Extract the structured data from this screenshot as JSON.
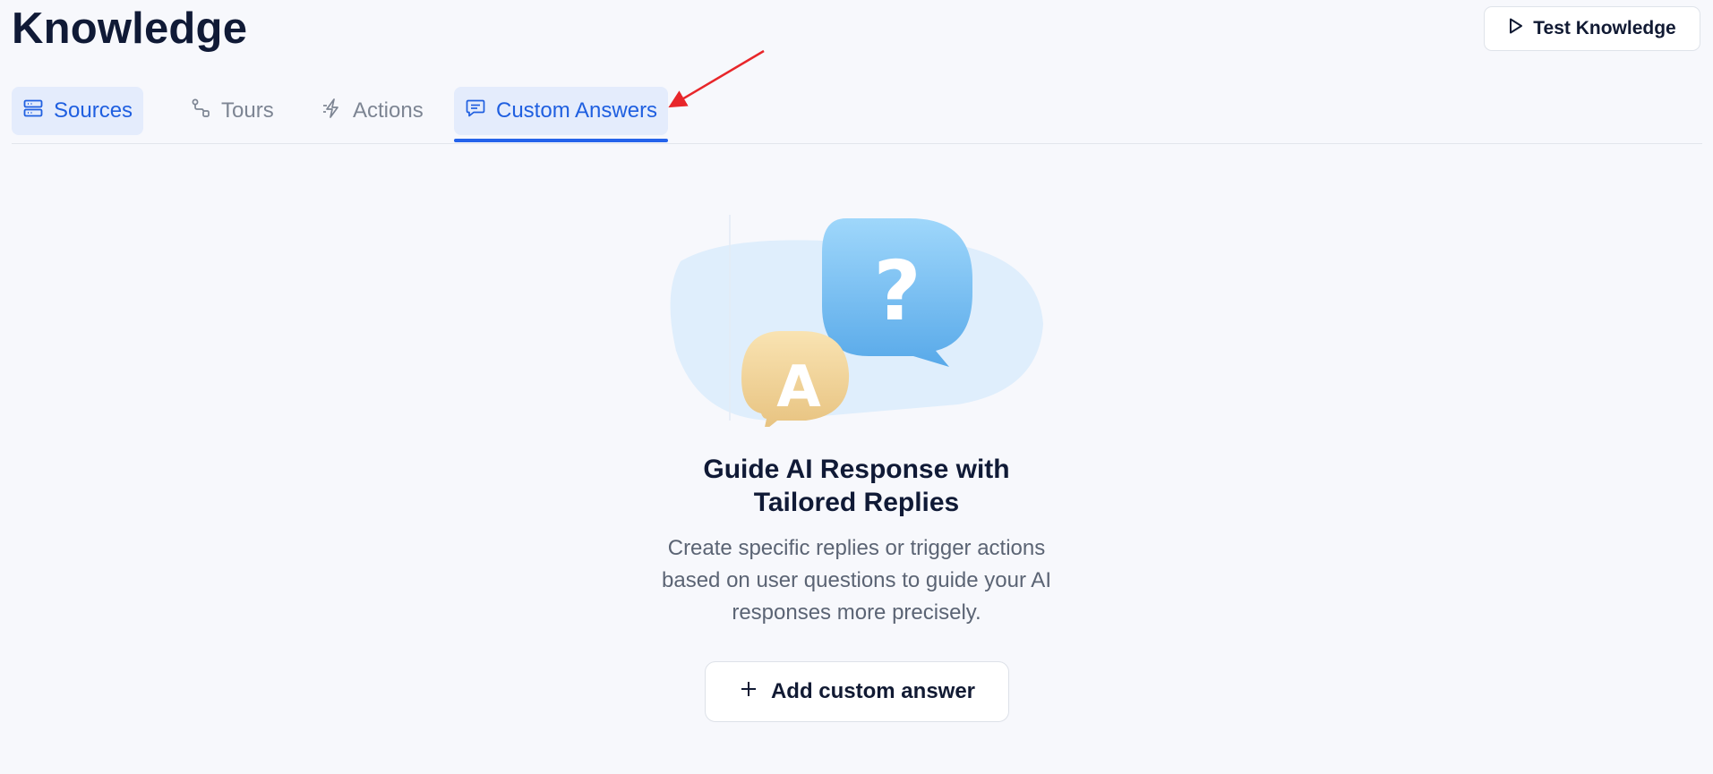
{
  "page": {
    "title": "Knowledge"
  },
  "header": {
    "test_button_label": "Test Knowledge",
    "test_button_icon": "play-icon"
  },
  "tabs": [
    {
      "label": "Sources",
      "icon": "database-icon",
      "state": "highlighted"
    },
    {
      "label": "Tours",
      "icon": "route-icon",
      "state": "inactive"
    },
    {
      "label": "Actions",
      "icon": "zap-icon",
      "state": "inactive"
    },
    {
      "label": "Custom Answers",
      "icon": "message-square-icon",
      "state": "selected"
    }
  ],
  "empty_state": {
    "illustration": "question-answer-bubbles",
    "illustration_letters": {
      "question": "?",
      "answer": "A"
    },
    "headline_line1": "Guide AI Response with",
    "headline_line2": "Tailored Replies",
    "desc_line1": "Create specific replies or trigger actions",
    "desc_line2": "based on user questions to guide your AI",
    "desc_line3": "responses more precisely.",
    "add_button_label": "Add custom answer",
    "add_button_icon": "plus-icon"
  },
  "colors": {
    "accent": "#2563eb",
    "tab_active_bg": "#e4ecfc",
    "page_bg": "#f7f8fc",
    "annotation_arrow": "#e8262a"
  }
}
